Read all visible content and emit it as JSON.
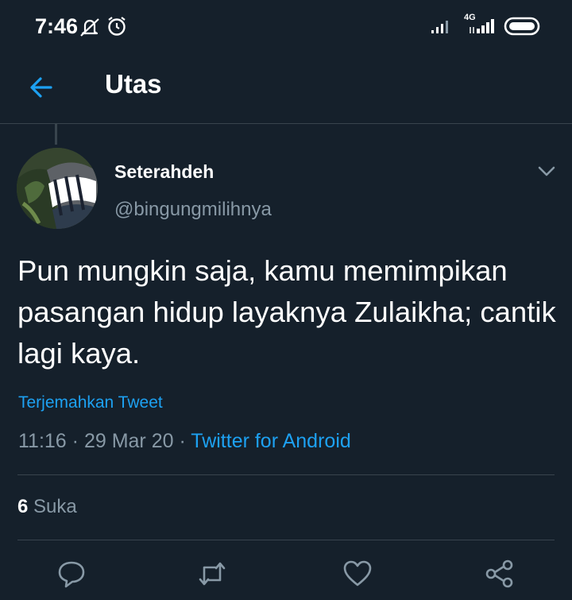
{
  "status_bar": {
    "time": "7:46",
    "icons": [
      "alarm-off-icon",
      "alarm-clock-icon",
      "signal-icon",
      "signal-4g-icon",
      "battery-icon"
    ],
    "network_label": "4G"
  },
  "header": {
    "back_icon": "arrow-left-icon",
    "title": "Utas"
  },
  "tweet": {
    "display_name": "Seterahdeh",
    "handle": "@bingungmilihnya",
    "text": "Pun mungkin saja, kamu memimpikan pasangan hidup layaknya Zulaikha; cantik lagi kaya.",
    "translate_label": "Terjemahkan Tweet",
    "time": "11:16",
    "date": "29 Mar 20",
    "separator": "·",
    "client": "Twitter for Android",
    "likes_count": "6",
    "likes_label": "Suka"
  },
  "actions": [
    "reply-icon",
    "retweet-icon",
    "like-icon",
    "share-icon"
  ],
  "colors": {
    "background": "#15202b",
    "accent": "#1da1f2",
    "secondary_text": "#8899a6",
    "divider": "#38444d"
  }
}
